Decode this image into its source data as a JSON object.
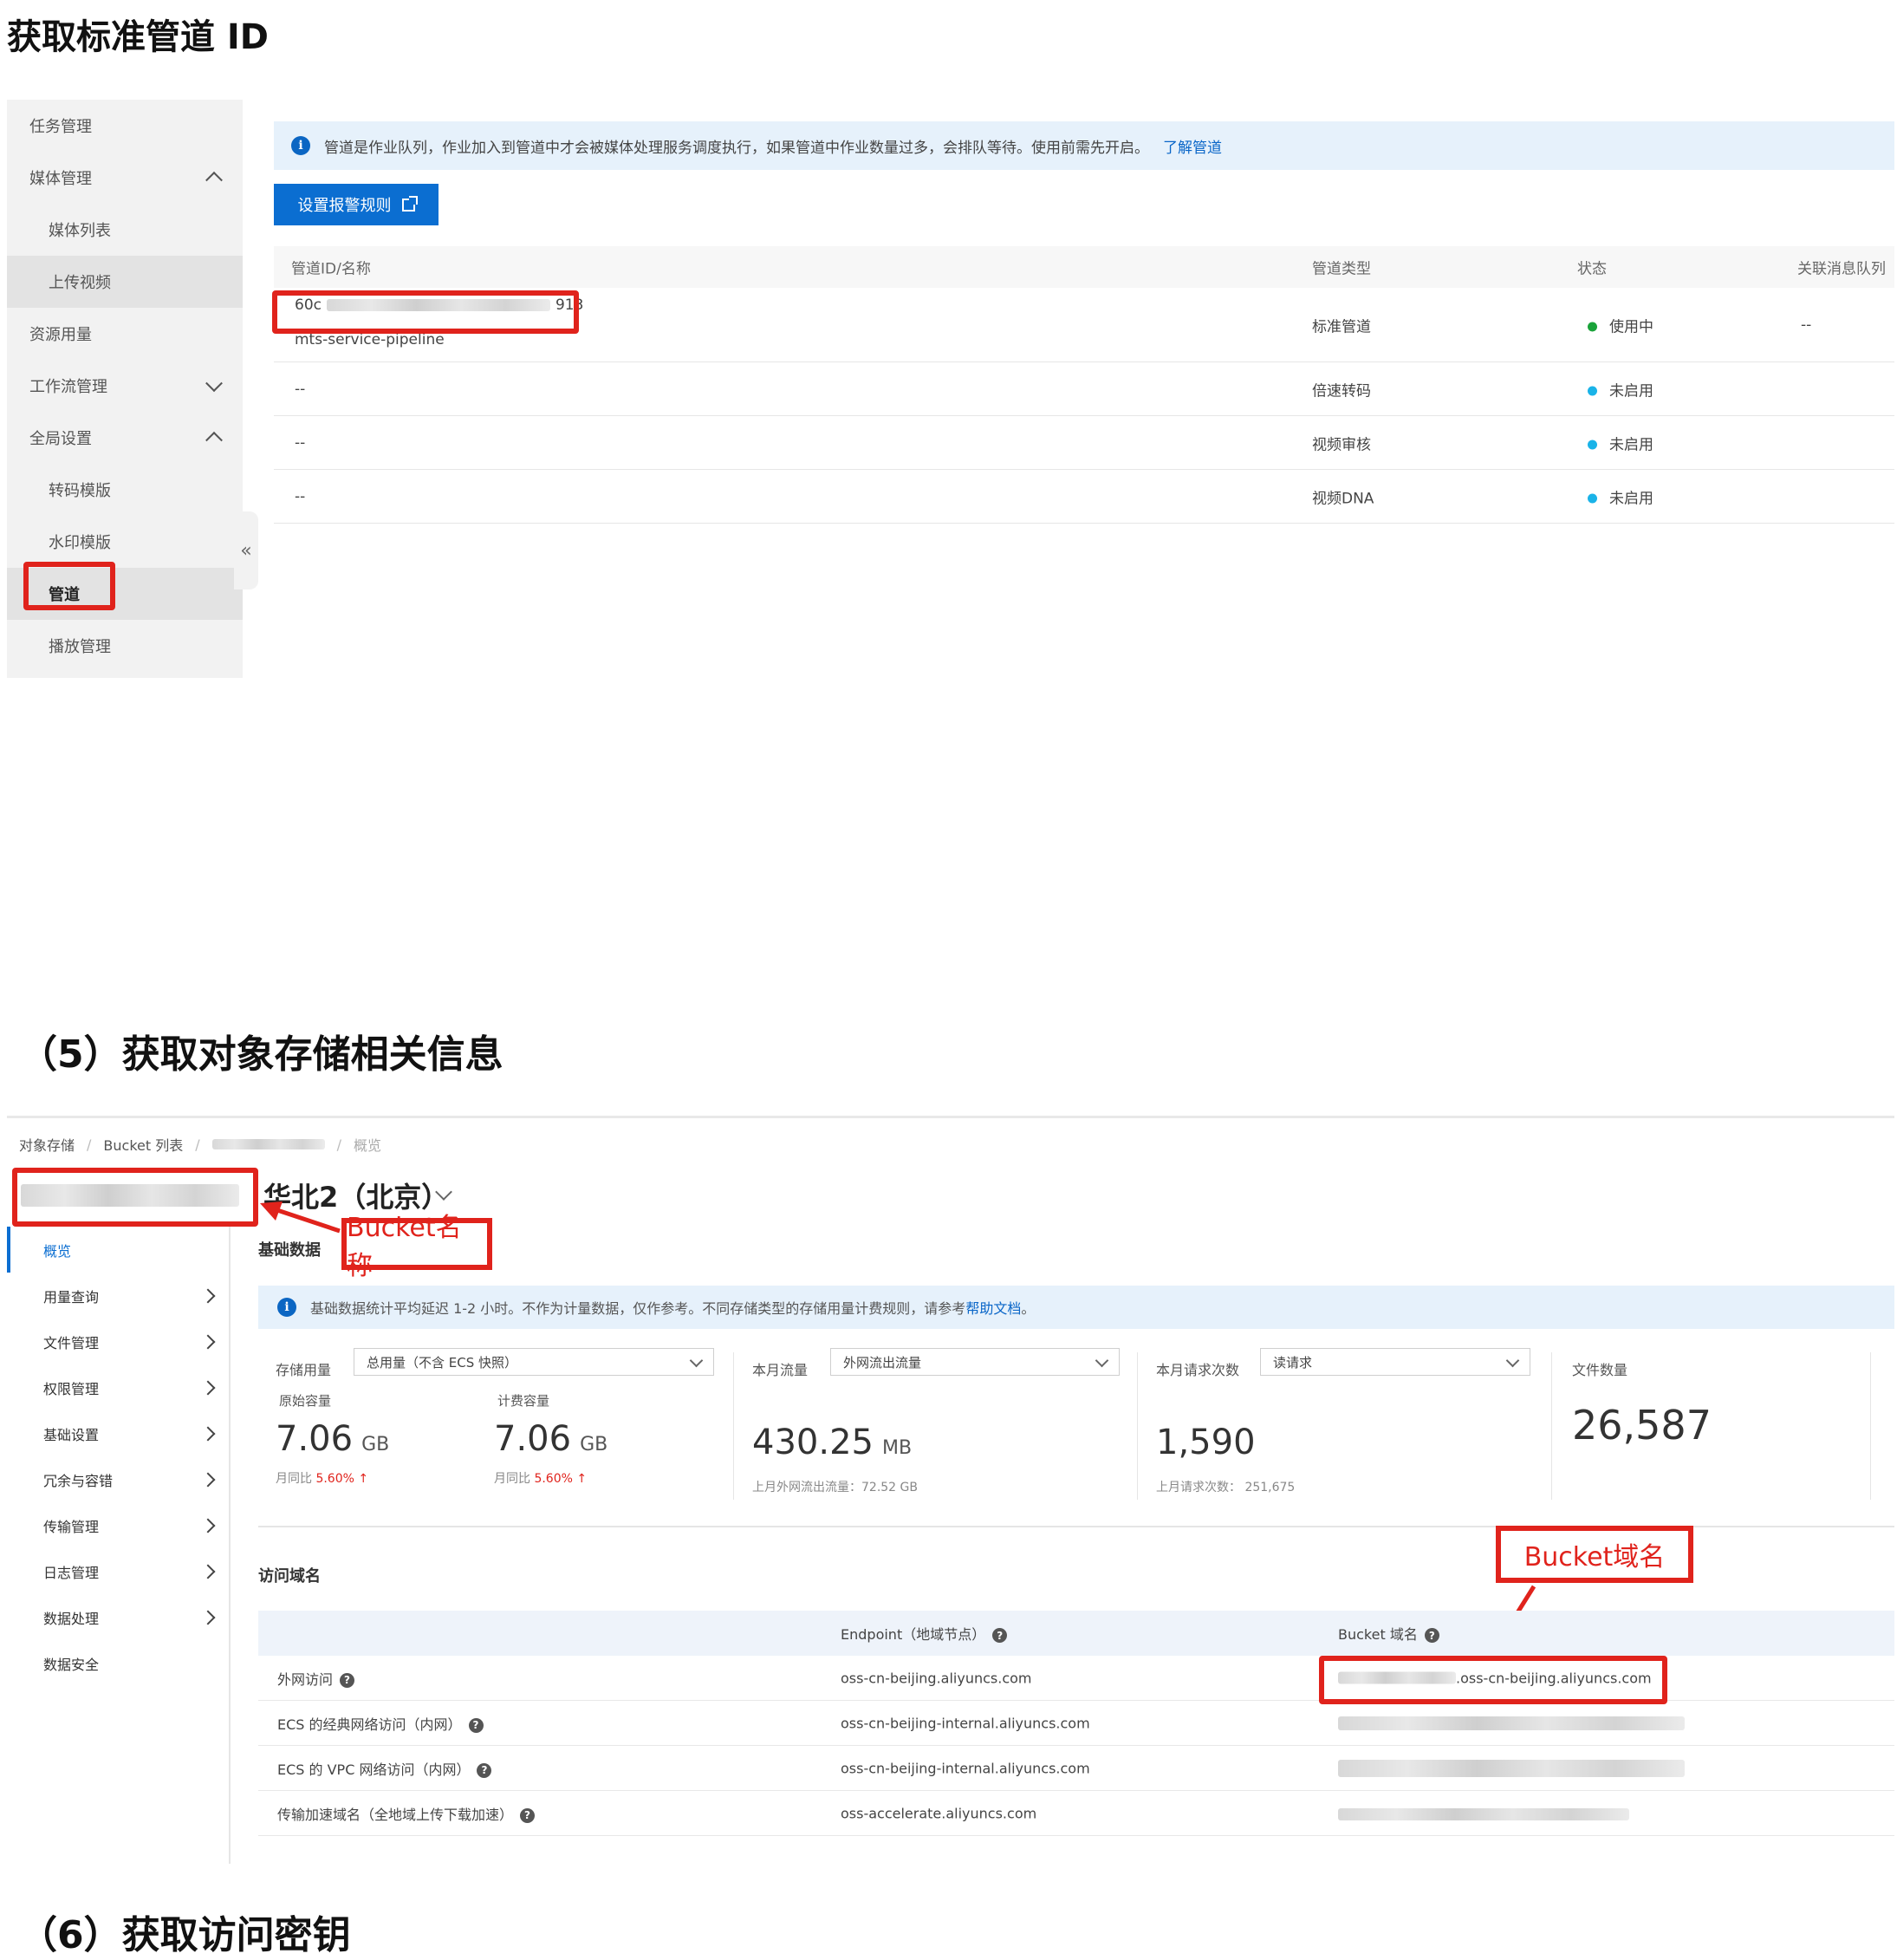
{
  "headings": {
    "h1": "获取标准管道 ID",
    "h5": "（5）获取对象存储相关信息",
    "h6": "（6）获取访问密钥"
  },
  "mps": {
    "sidebar": {
      "items": [
        {
          "label": "任务管理"
        },
        {
          "label": "媒体管理"
        },
        {
          "label": "媒体列表"
        },
        {
          "label": "上传视频"
        },
        {
          "label": "资源用量"
        },
        {
          "label": "工作流管理"
        },
        {
          "label": "全局设置"
        },
        {
          "label": "转码模版"
        },
        {
          "label": "水印模版"
        },
        {
          "label": "管道"
        },
        {
          "label": "播放管理"
        }
      ],
      "collapse_glyph": "«"
    },
    "notice": {
      "text": "管道是作业队列，作业加入到管道中才会被媒体处理服务调度执行，如果管道中作业数量过多，会排队等待。使用前需先开启。",
      "link": "了解管道"
    },
    "alert_button": "设置报警规则",
    "table": {
      "headers": [
        "管道ID/名称",
        "管道类型",
        "状态",
        "关联消息队列"
      ],
      "rows": [
        {
          "id_prefix": "60c",
          "id_suffix": "913",
          "name": "mts-service-pipeline",
          "type": "标准管道",
          "status": "使用中",
          "status_color": "#1aa33a",
          "queue": "--"
        },
        {
          "id_prefix": "--",
          "type": "倍速转码",
          "status": "未启用",
          "status_color": "#1ab3e8"
        },
        {
          "id_prefix": "--",
          "type": "视频审核",
          "status": "未启用",
          "status_color": "#1ab3e8"
        },
        {
          "id_prefix": "--",
          "type": "视频DNA",
          "status": "未启用",
          "status_color": "#1ab3e8"
        }
      ]
    }
  },
  "oss": {
    "breadcrumb": [
      "对象存储",
      "Bucket 列表",
      "概览"
    ],
    "region": "华北2（北京）",
    "annotation_bucket_name": "Bucket名称",
    "annotation_bucket_domain": "Bucket域名",
    "sidebar": {
      "items": [
        {
          "label": "概览"
        },
        {
          "label": "用量查询"
        },
        {
          "label": "文件管理"
        },
        {
          "label": "权限管理"
        },
        {
          "label": "基础设置"
        },
        {
          "label": "冗余与容错"
        },
        {
          "label": "传输管理"
        },
        {
          "label": "日志管理"
        },
        {
          "label": "数据处理"
        },
        {
          "label": "数据安全"
        }
      ]
    },
    "basic_title": "基础数据",
    "notice": {
      "text": "基础数据统计平均延迟 1-2 小时。不作为计量数据，仅作参考。不同存储类型的存储用量计费规则，请参考",
      "link": "帮助文档",
      "tail": "。"
    },
    "stats": {
      "storage": {
        "label": "存储用量",
        "select": "总用量（不含 ECS 快照）",
        "orig_label": "原始容量",
        "orig_value": "7.06",
        "orig_unit": "GB",
        "orig_yoy_label": "月同比",
        "orig_yoy": "5.60%",
        "bill_label": "计费容量",
        "bill_value": "7.06",
        "bill_unit": "GB",
        "bill_yoy_label": "月同比",
        "bill_yoy": "5.60%",
        "up_glyph": "↑"
      },
      "traffic": {
        "label": "本月流量",
        "select": "外网流出流量",
        "value": "430.25",
        "unit": "MB",
        "last": "上月外网流出流量：72.52 GB"
      },
      "requests": {
        "label": "本月请求次数",
        "select": "读请求",
        "value": "1,590",
        "last": "上月请求次数： 251,675"
      },
      "files": {
        "label": "文件数量",
        "value": "26,587"
      }
    },
    "domain_title": "访问域名",
    "domain_table": {
      "headers": [
        "",
        "Endpoint（地域节点）",
        "Bucket 域名"
      ],
      "rows": [
        {
          "label": "外网访问",
          "endpoint": "oss-cn-beijing.aliyuncs.com",
          "domain": ".oss-cn-beijing.aliyuncs.com"
        },
        {
          "label": "ECS 的经典网络访问（内网）",
          "endpoint": "oss-cn-beijing-internal.aliyuncs.com"
        },
        {
          "label": "ECS 的 VPC 网络访问（内网）",
          "endpoint": "oss-cn-beijing-internal.aliyuncs.com"
        },
        {
          "label": "传输加速域名（全地域上传下载加速）",
          "endpoint": "oss-accelerate.aliyuncs.com"
        }
      ],
      "help_glyph": "?"
    }
  },
  "icons": {
    "info": "i",
    "info_name": "info-icon",
    "help_name": "help-icon"
  }
}
